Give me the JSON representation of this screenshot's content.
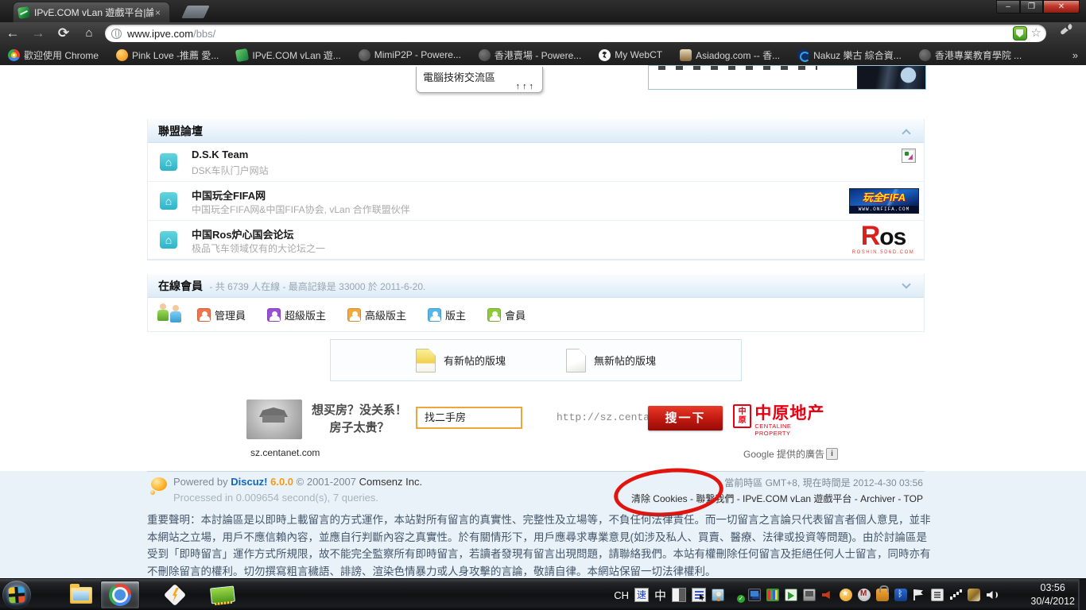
{
  "browser": {
    "tab_title": "IPvE.COM vLan 遊戲平台|論壇",
    "tab_close": "×",
    "window_controls": {
      "minimize": "–",
      "maximize": "❐",
      "close": "✕"
    },
    "nav": {
      "back": "←",
      "forward": "→",
      "reload": "⟳",
      "home": "⌂"
    },
    "url_host": "www.ipve.com",
    "url_path": "/bbs/",
    "star": "☆",
    "bookmarks": [
      {
        "label": "歡迎使用 Chrome"
      },
      {
        "label": "Pink Love -推薦 愛..."
      },
      {
        "label": "IPvE.COM vLan 遊..."
      },
      {
        "label": "MimiP2P - Powere..."
      },
      {
        "label": "香港賣場 - Powere..."
      },
      {
        "label": "My WebCT"
      },
      {
        "label": "Asiadog.com -- 香..."
      },
      {
        "label": "Nakuz 樂古 綜合資..."
      },
      {
        "label": "香港專業教育學院 ..."
      }
    ],
    "overflow_chevron": "»"
  },
  "page": {
    "float_panel": {
      "label": "電腦技術交流區",
      "arrows": "↑↑↑"
    },
    "alliance": {
      "title": "聯盟論壇",
      "house_glyph": "⌂",
      "rows": [
        {
          "title": "D.S.K Team",
          "desc": "DSK车队门户网站"
        },
        {
          "title": "中国玩全FIFA网",
          "desc": "中国玩全FIFA网&中国FIFA协会, vLan 合作联盟伙伴",
          "logo_text": "玩全FIFA",
          "logo_sub": "WWW.ONFIFA.COM"
        },
        {
          "title": "中国Ros炉心国会论坛",
          "desc": "极品飞车领域仅有的大论坛之一",
          "logo_r": "R",
          "logo_os": "os",
          "logo_sub": "ROSHIN.5D6D.COM"
        }
      ]
    },
    "online": {
      "title": "在線會員",
      "stats": "- 共 6739 人在線 - 最高記錄是 33000 於 2011-6-20.",
      "legend": [
        {
          "label": "管理員",
          "color": "#f3734a"
        },
        {
          "label": "超級版主",
          "color": "#9a4fd6"
        },
        {
          "label": "高級版主",
          "color": "#f2a93e"
        },
        {
          "label": "版主",
          "color": "#55b8ea"
        },
        {
          "label": "會員",
          "color": "#8ecb3a"
        }
      ]
    },
    "legend_box": {
      "new_posts": "有新帖的版塊",
      "no_new_posts": "無新帖的版塊"
    },
    "ad": {
      "slogan_line1": "想买房？没关系！",
      "slogan_line2": "房子太贵？",
      "search_text": "找二手房",
      "url": "http://sz.centanet.com",
      "button": "搜一下",
      "seal_top": "中",
      "seal_bottom": "原",
      "brand": "中原地产",
      "brand_sub": "CENTALINE PROPERTY",
      "source": "sz.centanet.com",
      "google_label": "Google 提供的廣告",
      "info_glyph": "i"
    },
    "footer": {
      "powered_prefix": "Powered by ",
      "discuz": "Discuz!",
      "version": " 6.0.0",
      "copyright": " © 2001-2007 ",
      "comsenz": "Comsenz Inc.",
      "processed": "Processed in 0.009654 second(s), 7 queries.",
      "timezone": "當前時區 GMT+8, 現在時間是 2012-4-30 03:56",
      "separator": " - ",
      "links": [
        "清除 Cookies",
        "聯繫我們",
        "IPvE.COM vLan 遊戲平台",
        "Archiver",
        "TOP"
      ],
      "disclaimer": "重要聲明：本討論區是以即時上載留言的方式運作，本站對所有留言的真實性、完整性及立場等，不負任何法律責任。而一切留言之言論只代表留言者個人意見，並非本網站之立場，用戶不應信賴內容，並應自行判斷內容之真實性。於有關情形下，用戶應尋求專業意見(如涉及私人、買賣、醫療、法律或投資等問題)。由於討論區是受到「即時留言」運作方式所規限，故不能完全監察所有即時留言，若讀者發現有留言出現問題，請聯絡我們。本站有權刪除任何留言及拒絕任何人士留言，同時亦有不刪除留言的權利。切勿撰寫粗言穢語、誹謗、渲染色情暴力或人身攻擊的言論，敬請自律。本網站保留一切法律權利。"
    }
  },
  "taskbar": {
    "ime_ch": "CH",
    "ime_speed": "速",
    "ime_zh": "中",
    "clock_time": "03:56",
    "clock_date": "30/4/2012"
  }
}
